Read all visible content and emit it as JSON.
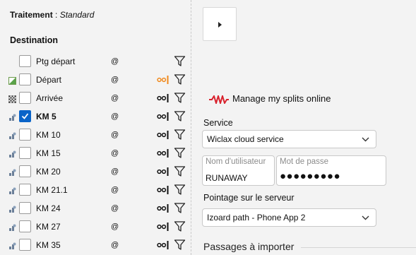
{
  "treatment": {
    "label": "Traitement",
    "separator": " : ",
    "value": "Standard"
  },
  "destination_title": "Destination",
  "points": [
    {
      "label": "Ptg départ",
      "at": "@",
      "icon": "none",
      "checked": false,
      "bold": false,
      "split": "none"
    },
    {
      "label": "Départ",
      "at": "@",
      "icon": "start-flag-icon",
      "checked": false,
      "bold": false,
      "split": "orange"
    },
    {
      "label": "Arrivée",
      "at": "@",
      "icon": "checkered-flag-icon",
      "checked": false,
      "bold": false,
      "split": "black"
    },
    {
      "label": "KM 5",
      "at": "@",
      "icon": "intermediate-icon",
      "checked": true,
      "bold": true,
      "split": "black"
    },
    {
      "label": "KM 10",
      "at": "@",
      "icon": "intermediate-icon",
      "checked": false,
      "bold": false,
      "split": "black"
    },
    {
      "label": "KM 15",
      "at": "@",
      "icon": "intermediate-icon",
      "checked": false,
      "bold": false,
      "split": "black"
    },
    {
      "label": "KM 20",
      "at": "@",
      "icon": "intermediate-icon",
      "checked": false,
      "bold": false,
      "split": "black"
    },
    {
      "label": "KM 21.1",
      "at": "@",
      "icon": "intermediate-icon",
      "checked": false,
      "bold": false,
      "split": "black"
    },
    {
      "label": "KM 24",
      "at": "@",
      "icon": "intermediate-icon",
      "checked": false,
      "bold": false,
      "split": "black"
    },
    {
      "label": "KM 27",
      "at": "@",
      "icon": "intermediate-icon",
      "checked": false,
      "bold": false,
      "split": "black"
    },
    {
      "label": "KM 35",
      "at": "@",
      "icon": "intermediate-icon",
      "checked": false,
      "bold": false,
      "split": "black"
    }
  ],
  "manage_link": "Manage my splits online",
  "service": {
    "label": "Service",
    "value": "Wiclax cloud service"
  },
  "username": {
    "placeholder": "Nom d'utilisateur",
    "value": "RUNAWAY"
  },
  "password": {
    "placeholder": "Mot de passe",
    "masked": "●●●●●●●●●"
  },
  "server_point": {
    "label": "Pointage sur le serveur",
    "value": "Izoard path - Phone App 2"
  },
  "passages_title": "Passages à importer",
  "colors": {
    "accent": "#0a64c8",
    "split_orange": "#f08a1e",
    "wave_red": "#d9232e"
  }
}
